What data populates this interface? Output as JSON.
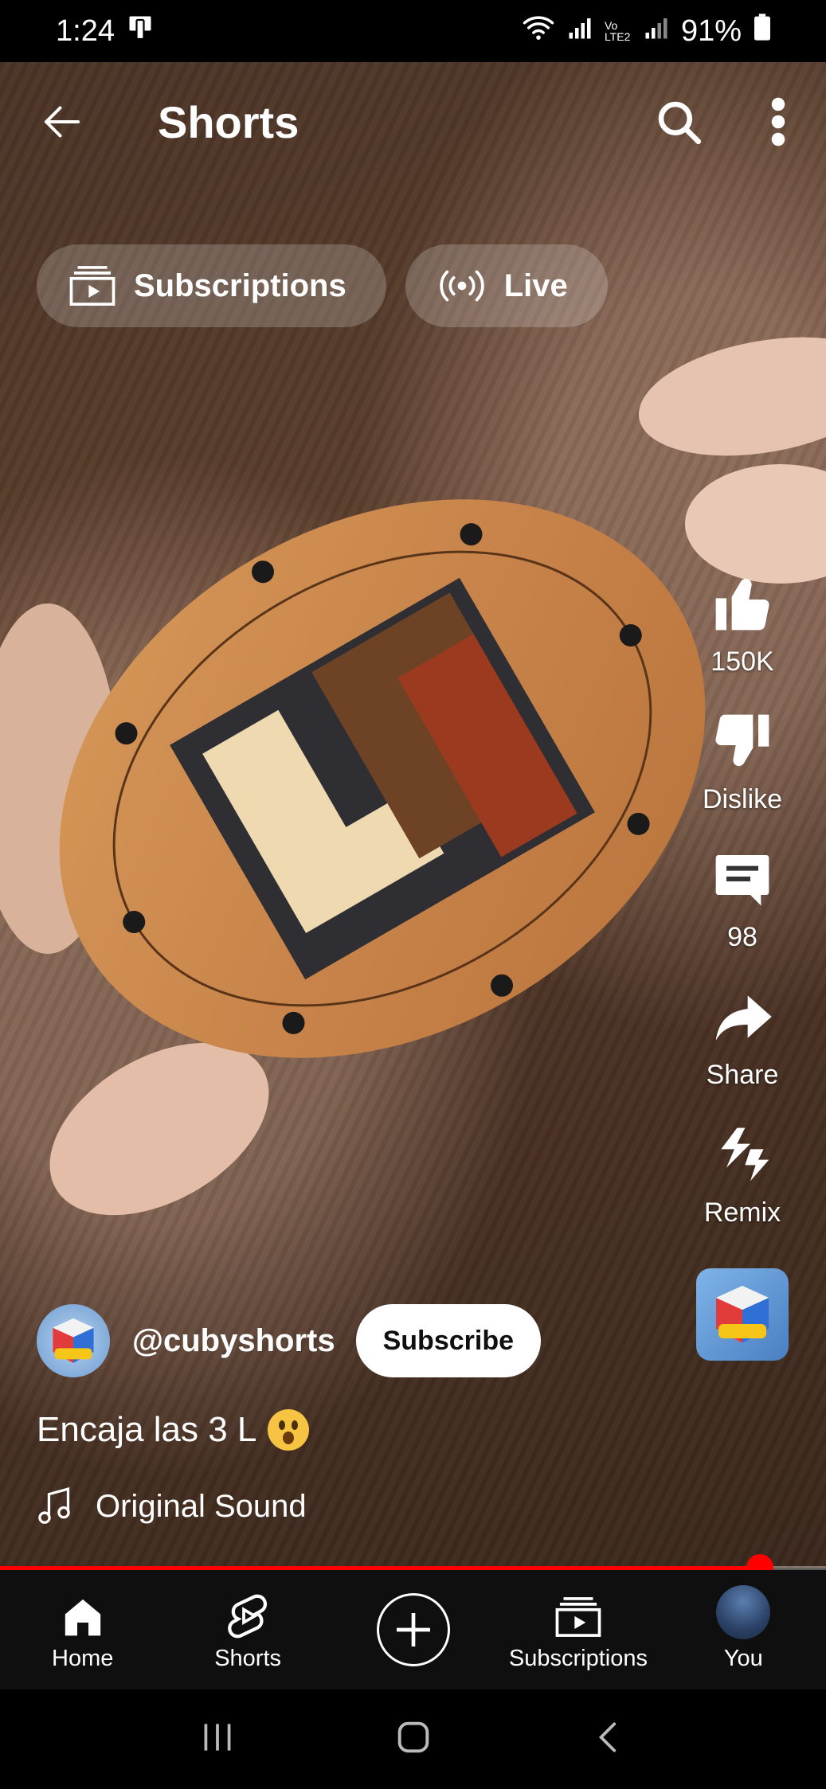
{
  "status_bar": {
    "time": "1:24",
    "network_label": "Vo LTE2",
    "battery": "91%"
  },
  "header": {
    "title": "Shorts"
  },
  "chips": [
    {
      "label": "Subscriptions",
      "icon": "subscriptions-icon"
    },
    {
      "label": "Live",
      "icon": "live-icon"
    }
  ],
  "actions": {
    "like_count": "150K",
    "dislike_label": "Dislike",
    "comment_count": "98",
    "share_label": "Share",
    "remix_label": "Remix"
  },
  "channel": {
    "handle": "@cubyshorts",
    "subscribe_label": "Subscribe"
  },
  "video": {
    "caption": "Encaja las 3 L",
    "sound": "Original Sound",
    "progress": 0.92
  },
  "bottom_nav": [
    {
      "label": "Home",
      "icon": "home-icon"
    },
    {
      "label": "Shorts",
      "icon": "shorts-icon"
    },
    {
      "label": "",
      "icon": "create-icon"
    },
    {
      "label": "Subscriptions",
      "icon": "subscriptions-icon"
    },
    {
      "label": "You",
      "icon": "avatar"
    }
  ],
  "colors": {
    "accent": "#ff0000",
    "nav_bg": "#0f0f0f"
  }
}
